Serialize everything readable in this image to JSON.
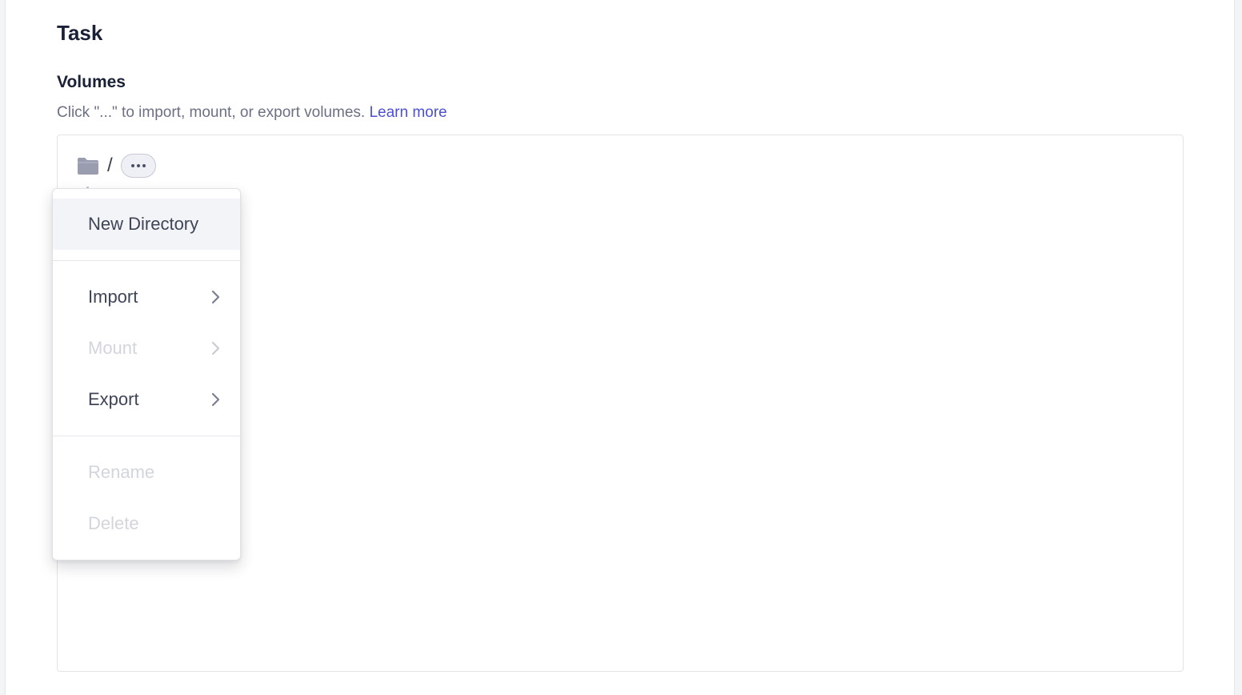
{
  "page": {
    "title": "Task"
  },
  "volumes": {
    "title": "Volumes",
    "description": "Click \"...\" to import, mount, or export volumes.",
    "learn_more_label": "Learn more",
    "path": "/",
    "more_button_label": "•••"
  },
  "menu": {
    "items": [
      {
        "label": "New Directory",
        "state": "hovered",
        "has_submenu": false
      },
      {
        "label": "Import",
        "state": "enabled",
        "has_submenu": true
      },
      {
        "label": "Mount",
        "state": "disabled",
        "has_submenu": true
      },
      {
        "label": "Export",
        "state": "enabled",
        "has_submenu": true
      },
      {
        "label": "Rename",
        "state": "disabled",
        "has_submenu": false
      },
      {
        "label": "Delete",
        "state": "disabled",
        "has_submenu": false
      }
    ]
  },
  "icons": {
    "folder": "folder-icon",
    "chevron": "chevron-right-icon",
    "more": "more-horizontal-icon"
  },
  "colors": {
    "link": "#4b4fd6",
    "heading": "#1a2036",
    "muted_text": "#6b7083",
    "disabled_text": "#d3d5dd",
    "folder_icon": "#9a9db0"
  }
}
